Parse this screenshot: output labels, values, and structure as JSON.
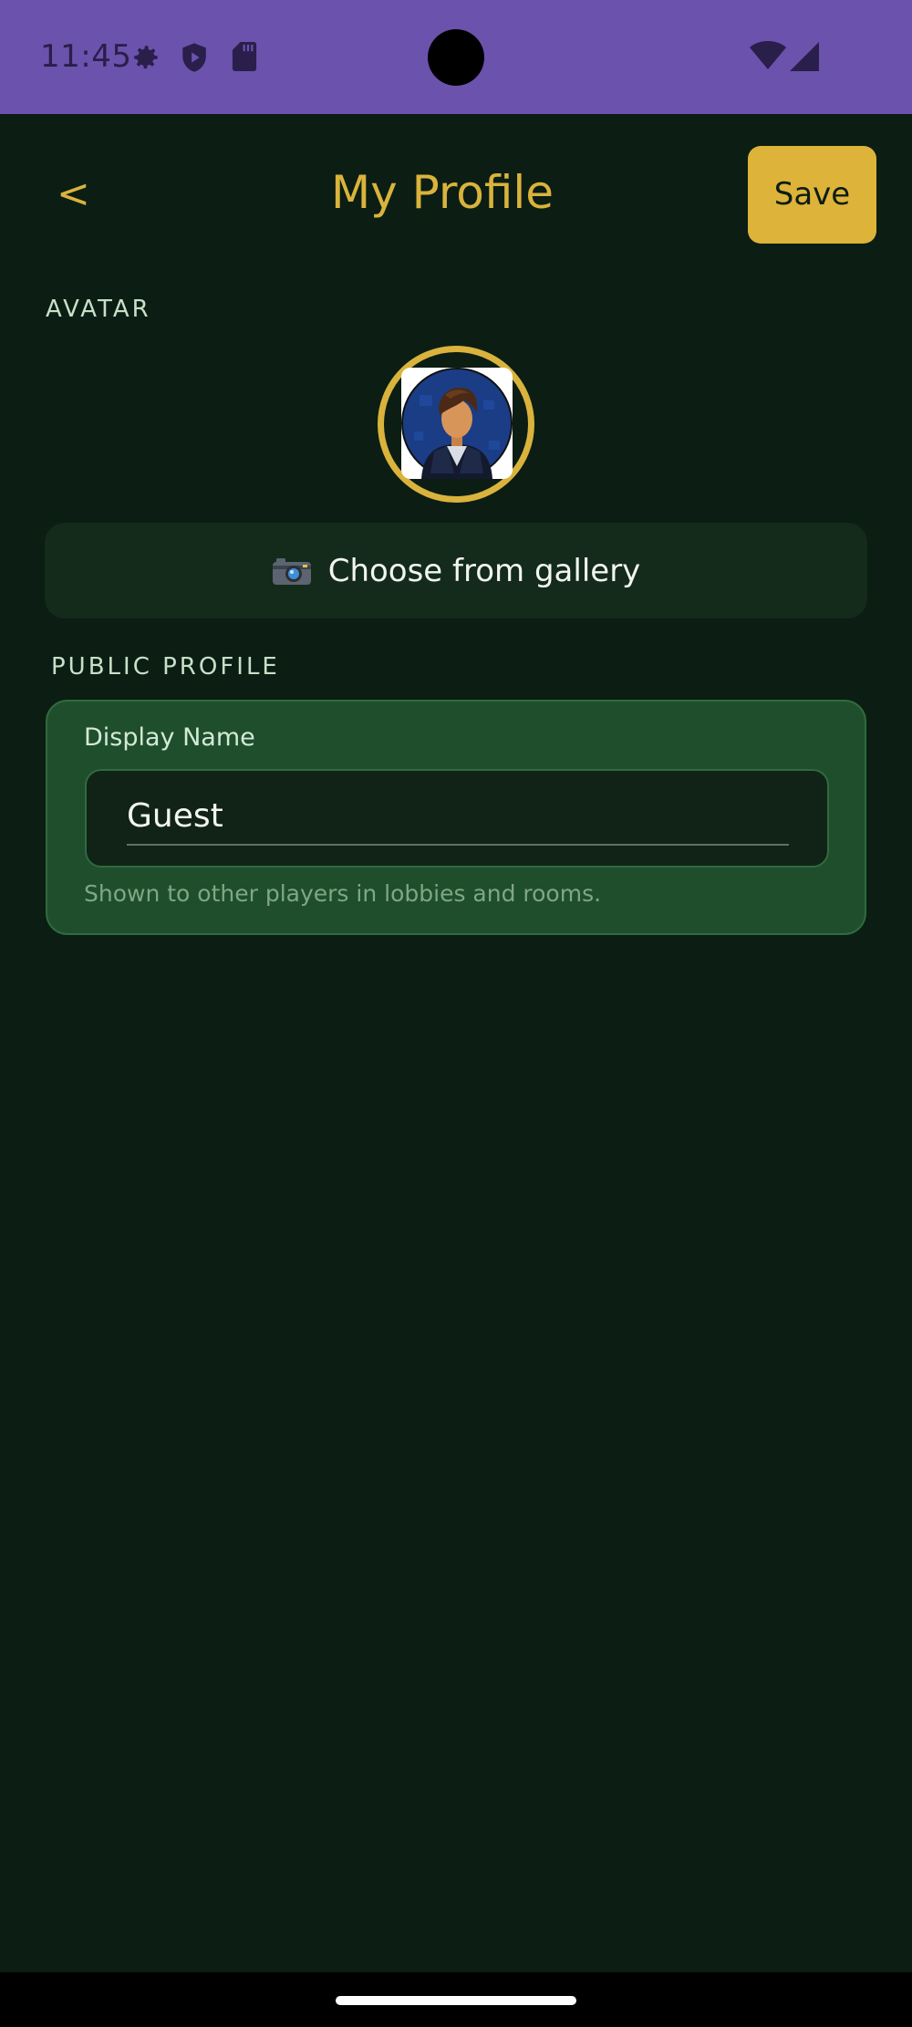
{
  "status_bar": {
    "time": "11:45",
    "background": "#6b52ad",
    "icons": [
      "gear-icon",
      "shield-icon",
      "sd-card-icon",
      "wifi-icon",
      "signal-icon"
    ]
  },
  "header": {
    "back_label": "<",
    "title": "My Profile",
    "save_label": "Save"
  },
  "avatar_section": {
    "label": "AVATAR",
    "gallery_button_label": "Choose from gallery",
    "gallery_icon": "camera-icon"
  },
  "public_profile": {
    "label": "PUBLIC PROFILE",
    "field_label": "Display Name",
    "display_name_value": "Guest",
    "helper_text": "Shown to other players in lobbies and rooms."
  },
  "colors": {
    "background": "#0c1d13",
    "accent_gold": "#d9b33c",
    "card_green": "#1f4e2d"
  }
}
